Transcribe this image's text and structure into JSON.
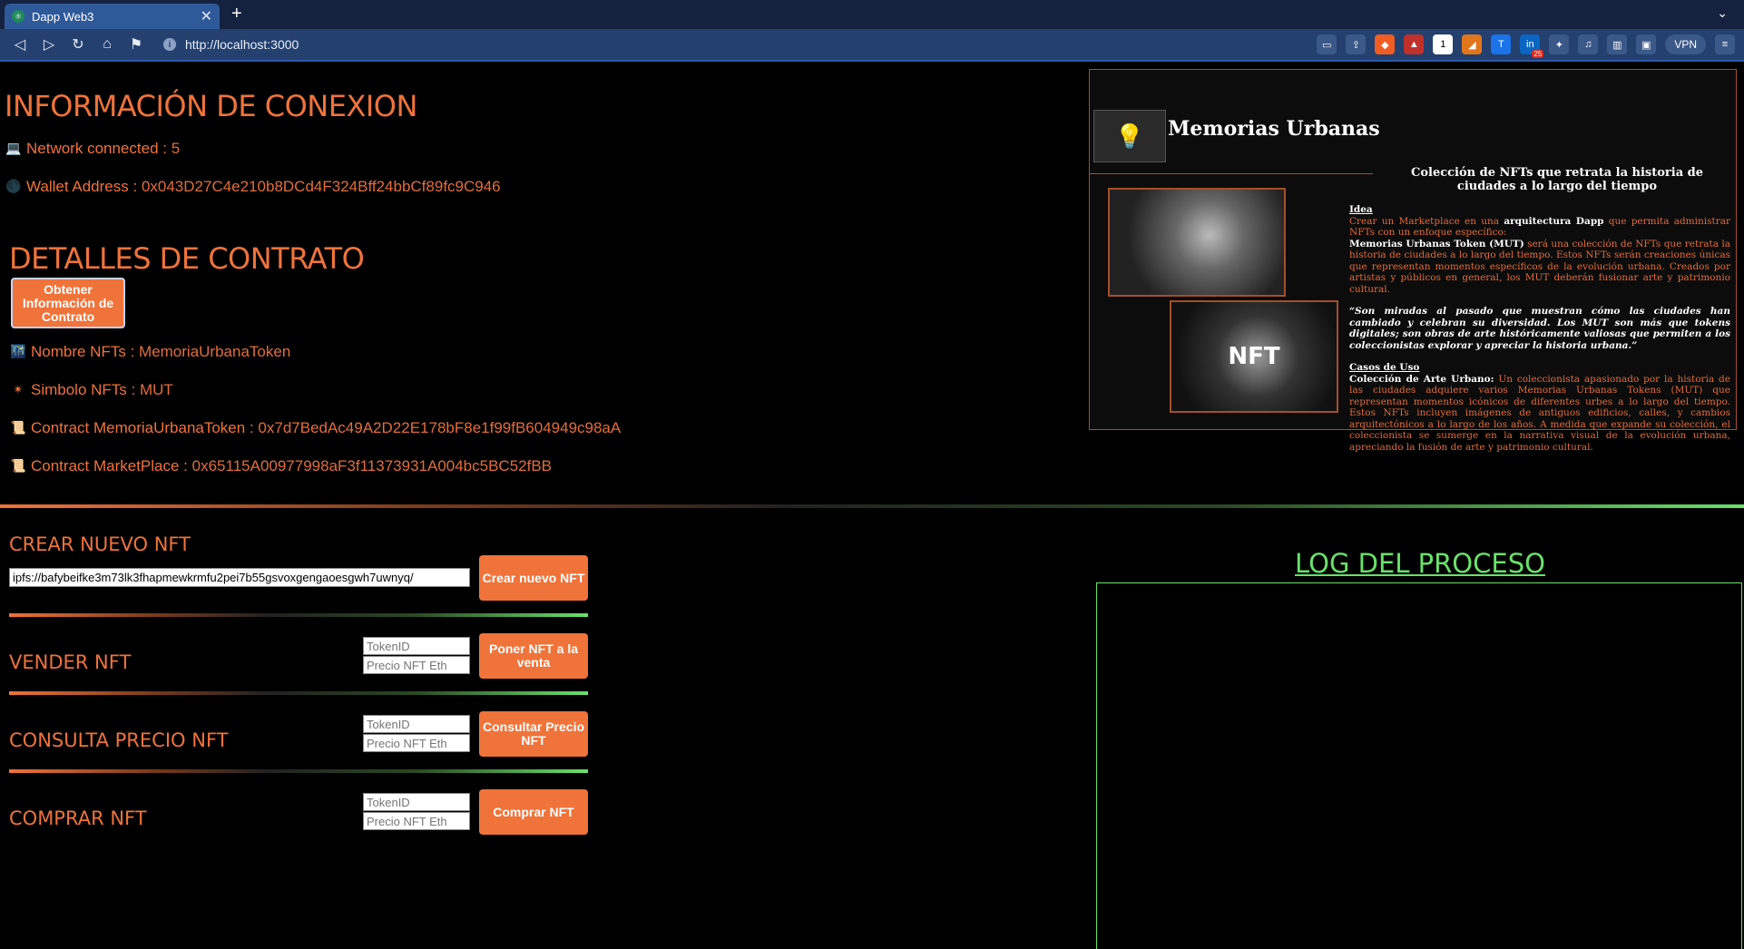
{
  "browser": {
    "tab_title": "Dapp Web3",
    "tab_close": "✕",
    "new_tab": "+",
    "tab_menu": "⌄",
    "url": "http://localhost:3000",
    "vpn_label": "VPN",
    "ext_badge": "25",
    "nav": {
      "back": "◁",
      "forward": "▷",
      "reload": "↻",
      "home": "⌂",
      "bookmark": "⚑"
    }
  },
  "connection": {
    "title": "INFORMACIÓN DE CONEXION",
    "network_label": "Network connected :",
    "network_value": "5",
    "wallet_label": "Wallet Address :",
    "wallet_value": "0x043D27C4e210b8DCd4F324Bff24bbCf89fc9C946"
  },
  "contract": {
    "title": "DETALLES DE CONTRATO",
    "get_info_button": "Obtener Información de Contrato",
    "name_label": "Nombre NFTs :",
    "name_value": "MemoriaUrbanaToken",
    "symbol_label": "Simbolo NFTs :",
    "symbol_value": "MUT",
    "token_contract_label": "Contract MemoriaUrbanaToken :",
    "token_contract_value": "0x7d7BedAc49A2D22E178bF8e1f99fB604949c98aA",
    "market_contract_label": "Contract MarketPlace :",
    "market_contract_value": "0x65115A00977998aF3f11373931A004bc5BC52fBB"
  },
  "preview": {
    "brand": "Memorias Urbanas",
    "subtitle": "Colección de NFTs que retrata la historia de ciudades a lo largo del tiempo",
    "img2_text": "NFT",
    "idea_head": "Idea",
    "idea_p1a": "Crear un Marketplace en una",
    "idea_p1b": "arquitectura Dapp",
    "idea_p1c": "que permita administrar NFTs con un enfoque específico:",
    "idea_p2a": "Memorias Urbanas Token (MUT)",
    "idea_p2b": "será una colección de NFTs que retrata la historia de ciudades a lo largo del tiempo. Estos NFTs serán creaciones únicas que representan momentos específicos de la evolución urbana. Creados por artistas y públicos en general, los MUT deberán fusionar arte y patrimonio cultural.",
    "quote": "“Son miradas al pasado que muestran cómo las ciudades han cambiado y celebran su diversidad. Los MUT son más que tokens digitales; son obras de arte históricamente valiosas que permiten a los coleccionistas explorar y apreciar la historia urbana.”",
    "uses_head": "Casos de Uso",
    "uses_a": "Colección de Arte Urbano:",
    "uses_b": "Un coleccionista apasionado por la historia de las ciudades adquiere varios Memorias Urbanas Tokens (MUT) que representan momentos icónicos de diferentes urbes a lo largo del tiempo. Estos NFTs incluyen imágenes de antiguos edificios, calles, y cambios arquitectónicos a lo largo de los años. A medida que expande su colección, el coleccionista se sumerge en la narrativa visual de la evolución urbana, apreciando la fusión de arte y patrimonio cultural."
  },
  "create": {
    "title": "CREAR NUEVO NFT",
    "uri_value": "ipfs://bafybeifke3m73lk3fhapmewkrmfu2pei7b55gsvoxgengaoesgwh7uwnyq/",
    "button": "Crear nuevo NFT"
  },
  "sell": {
    "title": "VENDER NFT",
    "token_placeholder": "TokenID",
    "price_placeholder": "Precio NFT Eth",
    "button": "Poner NFT a la venta"
  },
  "query": {
    "title": "CONSULTA PRECIO NFT",
    "token_placeholder": "TokenID",
    "price_placeholder": "Precio NFT Eth",
    "button": "Consultar Precio NFT"
  },
  "buy": {
    "title": "COMPRAR NFT",
    "token_placeholder": "TokenID",
    "price_placeholder": "Precio NFT Eth",
    "button": "Comprar NFT"
  },
  "log": {
    "title": "LOG DEL PROCESO"
  },
  "colors": {
    "accent": "#f0733a",
    "log_green": "#69e26a",
    "chrome": "#23406f"
  }
}
